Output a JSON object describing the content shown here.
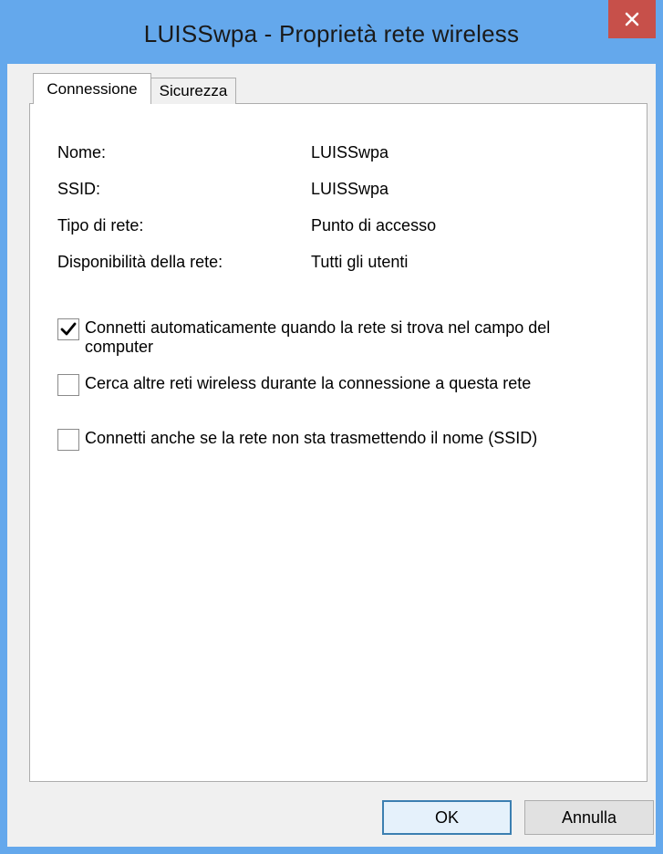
{
  "window": {
    "title": "LUISSwpa - Proprietà rete wireless",
    "close_icon": "close-icon",
    "accent_color": "#64a8ec",
    "close_color": "#c7504a"
  },
  "tabs": [
    {
      "label": "Connessione",
      "active": true
    },
    {
      "label": "Sicurezza",
      "active": false
    }
  ],
  "properties": {
    "name_label": "Nome:",
    "name_value": "LUISSwpa",
    "ssid_label": "SSID:",
    "ssid_value": "LUISSwpa",
    "type_label": "Tipo di rete:",
    "type_value": "Punto di accesso",
    "availability_label": "Disponibilità della rete:",
    "availability_value": "Tutti gli utenti"
  },
  "options": [
    {
      "label": "Connetti automaticamente quando la rete si trova nel campo del computer",
      "checked": true
    },
    {
      "label": "Cerca altre reti wireless durante la connessione a questa rete",
      "checked": false
    },
    {
      "label": "Connetti anche se la rete non sta trasmettendo il nome (SSID)",
      "checked": false
    }
  ],
  "buttons": {
    "ok_label": "OK",
    "cancel_label": "Annulla"
  }
}
